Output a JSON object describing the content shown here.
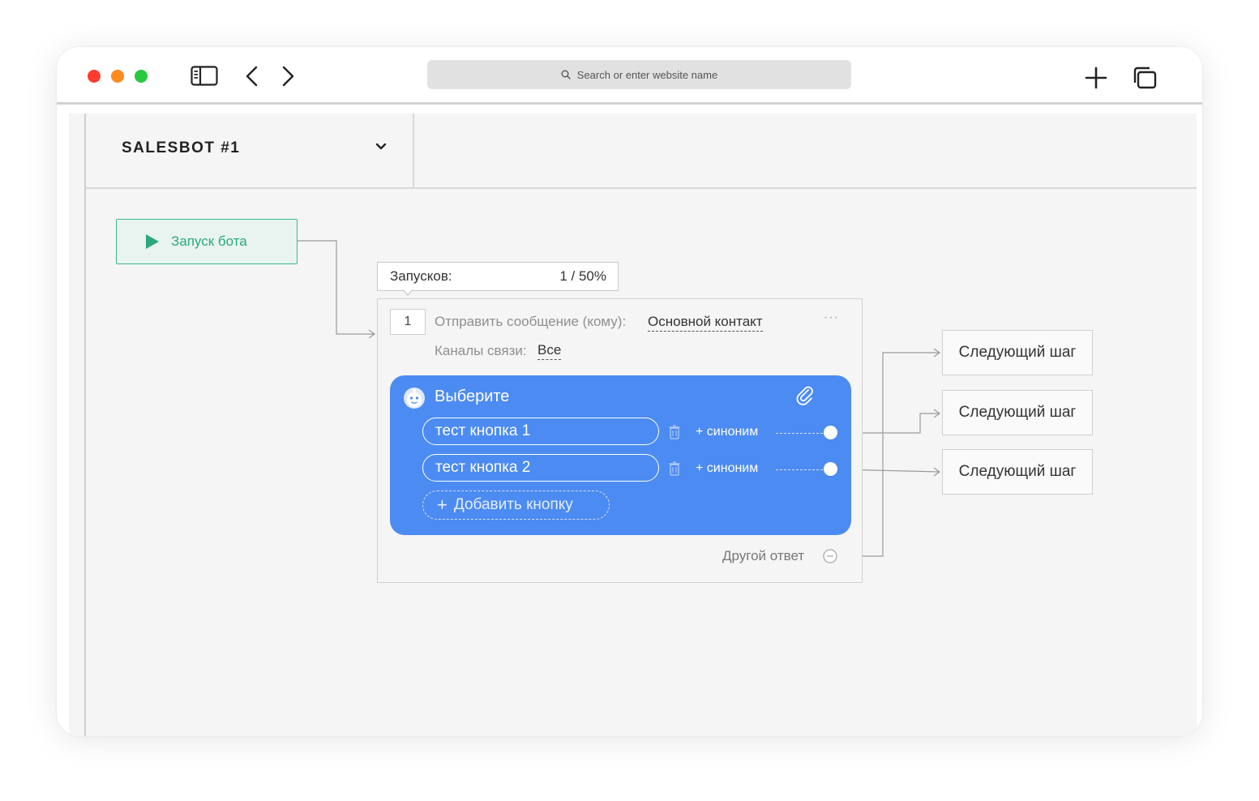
{
  "browser": {
    "address_placeholder": "Search or enter website name"
  },
  "header": {
    "bot_title": "SALESBOT #1"
  },
  "start_node": {
    "label": "Запуск бота"
  },
  "runs": {
    "label": "Запусков:",
    "value": "1 / 50%"
  },
  "message_step": {
    "number": "1",
    "send_label": "Отправить сообщение (кому):",
    "send_target": "Основной контакт",
    "more": "···",
    "channels_label": "Каналы связи:",
    "channels_value": "Все",
    "card": {
      "title": "Выберите",
      "buttons": [
        {
          "label": "тест кнопка 1",
          "synonym": "+ синоним"
        },
        {
          "label": "тест кнопка 2",
          "synonym": "+ синоним"
        }
      ],
      "add_button": "Добавить кнопку"
    },
    "other_answer": "Другой ответ"
  },
  "next_steps": [
    {
      "label": "Следующий шаг"
    },
    {
      "label": "Следующий шаг"
    },
    {
      "label": "Следующий шаг"
    }
  ],
  "colors": {
    "card_blue": "#4c8bf1",
    "start_green": "#2aa97c"
  },
  "icons": [
    "search-icon",
    "sidebar-toggle-icon",
    "back-arrow-icon",
    "forward-arrow-icon",
    "new-tab-plus-icon",
    "tabs-overview-icon",
    "chevron-down-icon",
    "play-icon",
    "bot-avatar-icon",
    "paperclip-icon",
    "trash-icon",
    "minus-circle-icon"
  ]
}
